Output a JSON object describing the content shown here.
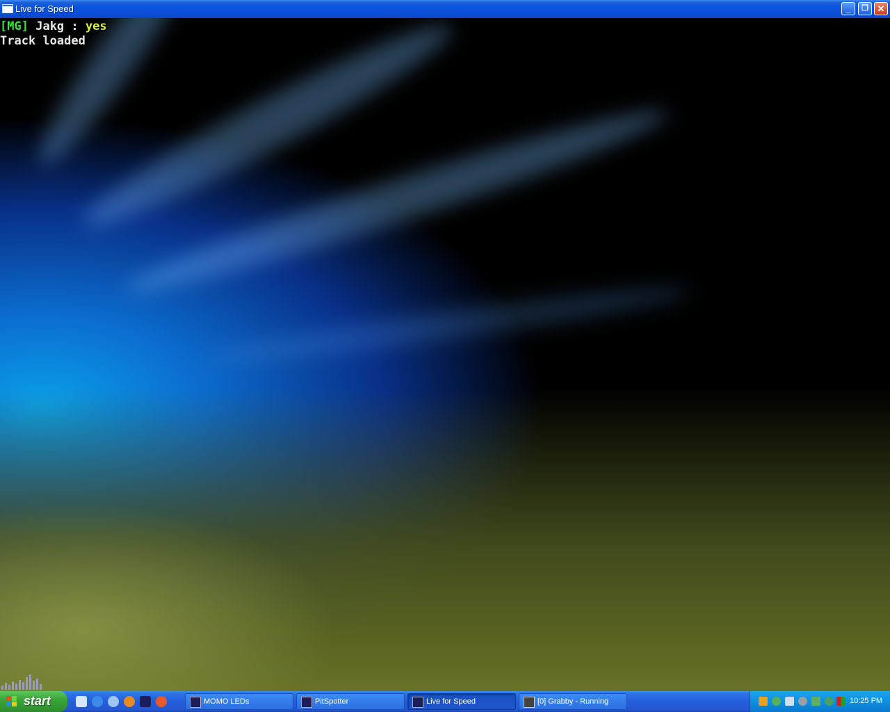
{
  "window": {
    "title": "Live for Speed",
    "buttons": {
      "minimize": "_",
      "restore": "❐",
      "close": "✕"
    }
  },
  "game": {
    "chat_lines": [
      {
        "bracket_open": "[",
        "tag": "MG",
        "bracket_close": "]",
        "player": " Jakg : ",
        "message": "yes"
      },
      {
        "text": "Track loaded"
      }
    ]
  },
  "taskbar": {
    "start_label": "start",
    "quick_launch": [
      "desktop-icon",
      "ie-icon",
      "messenger-icon",
      "firefox-icon",
      "lfs-icon",
      "app-icon"
    ],
    "tasks": [
      {
        "label": "MOMO LEDs",
        "icon": "lfs-icon",
        "active": false
      },
      {
        "label": "PitSpotter",
        "icon": "lfs-icon",
        "active": false
      },
      {
        "label": "Live for Speed",
        "icon": "lfs-icon",
        "active": true
      },
      {
        "label": "[0] Grabby - Running",
        "icon": "monitor-icon",
        "active": false
      }
    ],
    "tray": {
      "icons": [
        "network-icon",
        "users-icon",
        "volume-icon",
        "shield-icon",
        "sync-icon",
        "antivirus-icon",
        "app-tray-icon"
      ],
      "clock": "10:25 PM"
    }
  },
  "colors": {
    "chat_tag": "#39e03c",
    "chat_message": "#d8f040",
    "chat_text": "#e8e8e8"
  }
}
